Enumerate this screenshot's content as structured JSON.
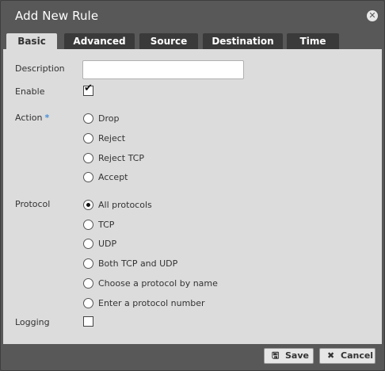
{
  "dialog": {
    "title": "Add New Rule",
    "close_icon": "close-icon"
  },
  "tabs": [
    {
      "label": "Basic",
      "active": true
    },
    {
      "label": "Advanced",
      "active": false
    },
    {
      "label": "Source",
      "active": false
    },
    {
      "label": "Destination",
      "active": false
    },
    {
      "label": "Time",
      "active": false
    }
  ],
  "form": {
    "description": {
      "label": "Description",
      "value": "",
      "placeholder": ""
    },
    "enable": {
      "label": "Enable",
      "checked": true
    },
    "action": {
      "label": "Action",
      "required_mark": "*",
      "options": [
        "Drop",
        "Reject",
        "Reject TCP",
        "Accept"
      ],
      "selected": null
    },
    "protocol": {
      "label": "Protocol",
      "options": [
        "All protocols",
        "TCP",
        "UDP",
        "Both TCP and UDP",
        "Choose a protocol by name",
        "Enter a protocol number"
      ],
      "selected": "All protocols"
    },
    "logging": {
      "label": "Logging",
      "checked": false
    }
  },
  "footer": {
    "save_label": "Save",
    "cancel_label": "Cancel",
    "save_icon": "floppy-icon",
    "cancel_icon": "x-icon"
  },
  "colors": {
    "dialog_bg": "#585858",
    "panel_bg": "#dcdcdc",
    "tab_bg": "#3a3a3a",
    "required_accent": "#4a90d9"
  }
}
